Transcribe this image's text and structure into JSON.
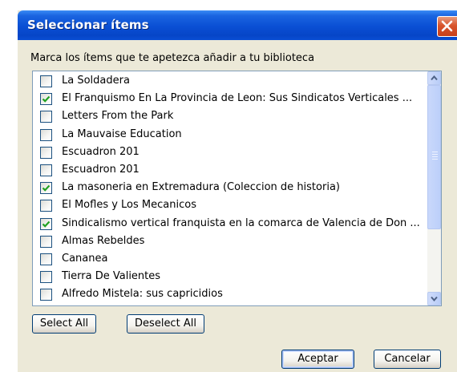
{
  "dialog": {
    "title": "Seleccionar ítems",
    "instruction": "Marca los ítems que te apetezca añadir a tu biblioteca"
  },
  "items": [
    {
      "label": "La Soldadera",
      "checked": false
    },
    {
      "label": "El Franquismo En La Provincia de Leon: Sus Sindicatos Verticales ...",
      "checked": true
    },
    {
      "label": "Letters From the Park",
      "checked": false
    },
    {
      "label": "La Mauvaise Education",
      "checked": false
    },
    {
      "label": "Escuadron 201",
      "checked": false
    },
    {
      "label": "Escuadron 201",
      "checked": false
    },
    {
      "label": "La masoneria en Extremadura (Coleccion de historia)",
      "checked": true
    },
    {
      "label": "El Mofles y Los Mecanicos",
      "checked": false
    },
    {
      "label": "Sindicalismo vertical franquista en la comarca de Valencia de Don ...",
      "checked": true
    },
    {
      "label": "Almas Rebeldes",
      "checked": false
    },
    {
      "label": "Cananea",
      "checked": false
    },
    {
      "label": "Tierra De Valientes",
      "checked": false
    },
    {
      "label": "Alfredo Mistela: sus capricidios",
      "checked": false
    }
  ],
  "buttons": {
    "select_all": "Select All",
    "deselect_all": "Deselect All",
    "accept": "Aceptar",
    "cancel": "Cancelar"
  },
  "colors": {
    "titlebar": "#0a4fd4",
    "window_bg": "#ece9d8",
    "close_button": "#d8542c",
    "check_mark": "#21a121"
  },
  "icons": {
    "close": "close-icon",
    "check": "checkmark-icon",
    "scroll_up": "arrow-up-icon",
    "scroll_down": "arrow-down-icon"
  }
}
